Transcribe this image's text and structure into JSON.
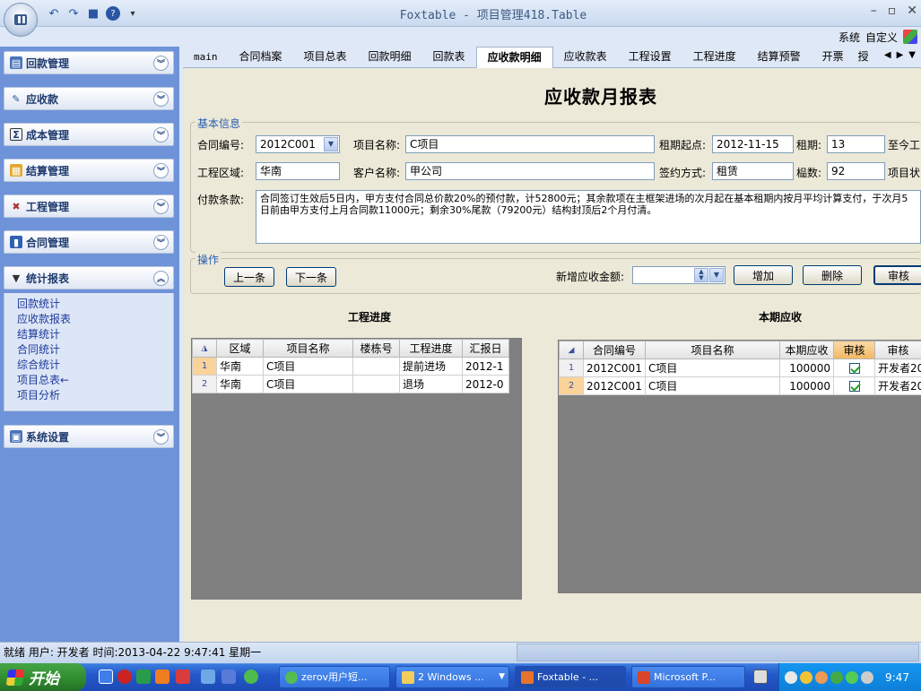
{
  "window": {
    "title": "Foxtable - 项目管理418.Table"
  },
  "topright": {
    "system": "系统",
    "custom": "自定义"
  },
  "sidebar": {
    "groups": [
      {
        "label": "回款管理"
      },
      {
        "label": "应收款"
      },
      {
        "label": "成本管理"
      },
      {
        "label": "结算管理"
      },
      {
        "label": "工程管理"
      },
      {
        "label": "合同管理"
      },
      {
        "label": "统计报表"
      },
      {
        "label": "系统设置"
      }
    ],
    "stat_items": [
      "回款统计",
      "应收款报表",
      "结算统计",
      "合同统计",
      "综合统计",
      "项目总表←",
      "项目分析"
    ]
  },
  "tabs": [
    "main",
    "合同档案",
    "项目总表",
    "回款明细",
    "回款表",
    "应收款明细",
    "应收款表",
    "工程设置",
    "工程进度",
    "结算预警",
    "开票",
    "授"
  ],
  "active_tab": "应收款明细",
  "report": {
    "title": "应收款月报表"
  },
  "basic": {
    "legend": "基本信息",
    "contract_no_label": "合同编号:",
    "contract_no": "2012C001",
    "project_name_label": "项目名称:",
    "project_name": "C项目",
    "lease_start_label": "租期起点:",
    "lease_start": "2012-11-15",
    "lease_term_label": "租期:",
    "lease_term": "13",
    "until_label": "至今工",
    "area_label": "工程区域:",
    "area": "华南",
    "client_label": "客户名称:",
    "client": "甲公司",
    "sign_label": "签约方式:",
    "sign": "租赁",
    "count_label": "榀数:",
    "count": "92",
    "proj_status_label": "项目状",
    "terms_label": "付款条款:",
    "terms": "合同签订生效后5日内，甲方支付合同总价款20%的预付款，计52800元；其余款项在主框架进场的次月起在基本租期内按月平均计算支付，于次月5日前由甲方支付上月合同款11000元；剩余30%尾款（79200元）结构封顶后2个月付清。"
  },
  "ops": {
    "legend": "操作",
    "prev": "上一条",
    "next": "下一条",
    "new_amount_label": "新增应收金额:",
    "add": "增加",
    "delete": "删除",
    "audit": "审核"
  },
  "progress": {
    "title": "工程进度",
    "headers": [
      "区域",
      "项目名称",
      "楼栋号",
      "工程进度",
      "汇报日"
    ],
    "rows": [
      {
        "n": "1",
        "area": "华南",
        "name": "C项目",
        "bldg": "",
        "stage": "提前进场",
        "date": "2012-1"
      },
      {
        "n": "2",
        "area": "华南",
        "name": "C项目",
        "bldg": "",
        "stage": "退场",
        "date": "2012-0"
      }
    ]
  },
  "receivable": {
    "title": "本期应收",
    "headers": [
      "合同编号",
      "项目名称",
      "本期应收",
      "审核",
      "审核"
    ],
    "rows": [
      {
        "n": "1",
        "contract": "2012C001",
        "name": "C项目",
        "amount": "100000",
        "checked": true,
        "auditor": "开发者20"
      },
      {
        "n": "2",
        "contract": "2012C001",
        "name": "C项目",
        "amount": "100000",
        "checked": true,
        "auditor": "开发者20"
      }
    ]
  },
  "status": {
    "text": "就绪 用户: 开发者  时间:2013-04-22 9:47:41  星期一"
  },
  "taskbar": {
    "start": "开始",
    "items": [
      "zerov用户短...",
      "2 Windows ...",
      "Foxtable - ...",
      "Microsoft P..."
    ],
    "clock": "9:47"
  }
}
